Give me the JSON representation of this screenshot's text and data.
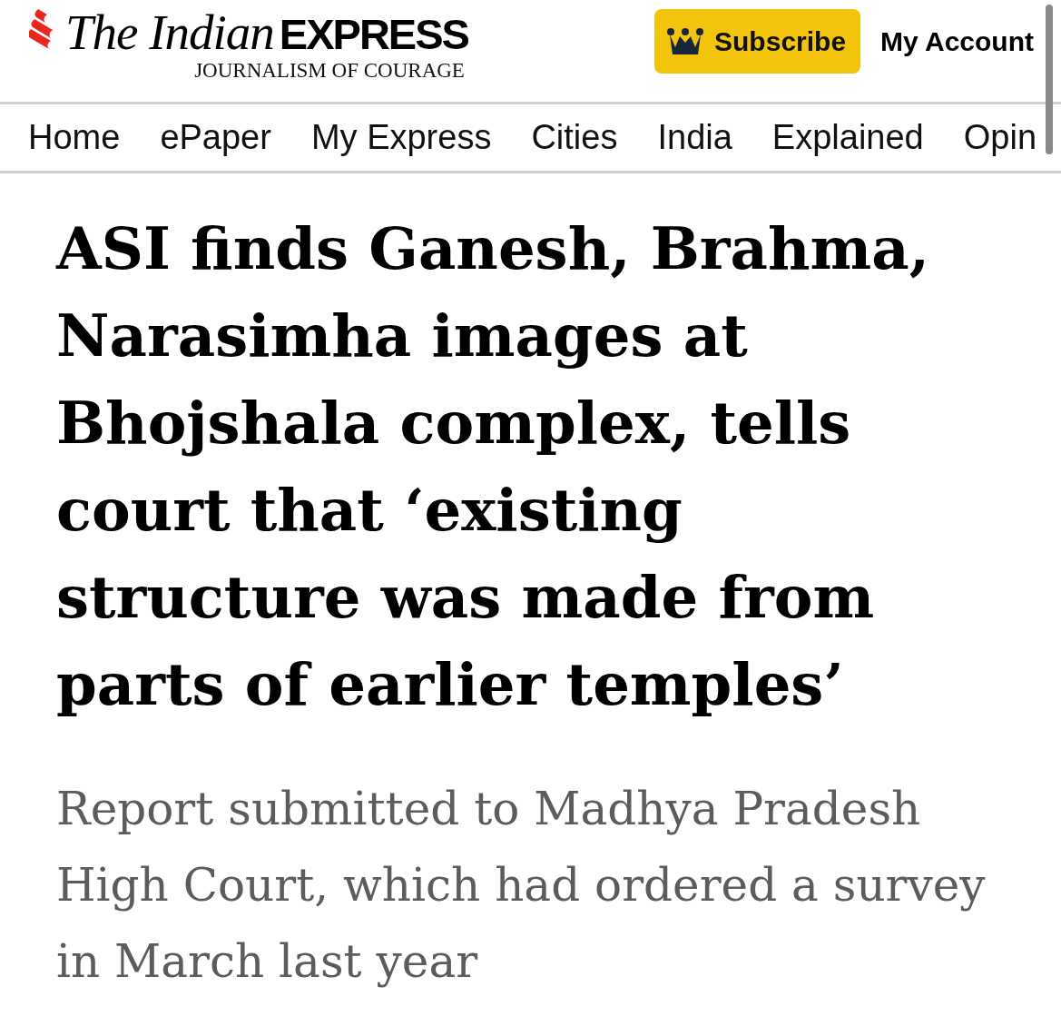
{
  "header": {
    "logo": {
      "title_italic": "The Indian",
      "title_bold": "EXPRESS",
      "tagline": "JOURNALISM OF COURAGE"
    },
    "subscribe_button": "Subscribe",
    "account_link": "My Account"
  },
  "nav": {
    "items": [
      "Home",
      "ePaper",
      "My Express",
      "Cities",
      "India",
      "Explained",
      "Opin"
    ]
  },
  "article": {
    "headline": "ASI finds Ganesh, Brahma, Narasimha images at Bhojshala complex, tells court that ‘existing structure was made from parts of earlier temples’",
    "deck": "Report submitted to Madhya Pradesh High Court, which had ordered a survey in March last year"
  }
}
